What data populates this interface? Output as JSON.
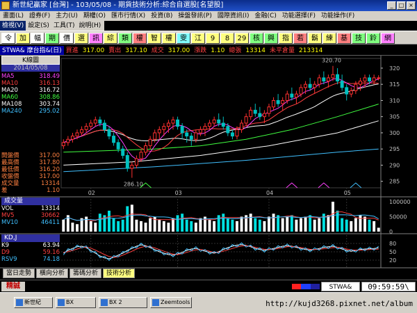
{
  "window": {
    "title": "新世紀贏家 [台灣] - 103/05/08 - 期貨技術分析:綜合自選股[名望股]",
    "controls": [
      "_",
      "□",
      "×"
    ]
  },
  "menu": {
    "items": [
      "畫面(L)",
      "證券(F)",
      "主力(U)",
      "期權(O)",
      "匯市行情(X)",
      "投資(B)",
      "操盤發訊(P)",
      "國際資訊(I)",
      "金融(C)",
      "功能選擇(F)",
      "功能操作(F)"
    ],
    "items2": [
      "檢視(V)",
      "設定(S)",
      "工具(T)",
      "說明(H)"
    ]
  },
  "toolbar": {
    "buttons": [
      {
        "label": "令",
        "color": "#ffffff"
      },
      {
        "label": "加",
        "color": "#ffff80"
      },
      {
        "label": "幅",
        "color": "#ffffff"
      },
      {
        "label": "期",
        "color": "#80ff80"
      },
      {
        "label": "價",
        "color": "#ffffff"
      },
      {
        "label": "選",
        "color": "#ffff80"
      },
      {
        "label": "訊",
        "color": "#ff80ff"
      },
      {
        "label": "綜",
        "color": "#ffff80"
      },
      {
        "label": "類",
        "color": "#80ff80"
      },
      {
        "label": "權",
        "color": "#ff8080"
      },
      {
        "label": "智",
        "color": "#ffff80"
      },
      {
        "label": "權",
        "color": "#ffff80"
      },
      {
        "label": "雯",
        "color": "#80ffff"
      },
      {
        "label": "江",
        "color": "#ffff80"
      },
      {
        "label": "9",
        "color": "#ffff80"
      },
      {
        "label": "8",
        "color": "#ffff80"
      },
      {
        "label": "29",
        "color": "#ffff80"
      },
      {
        "label": "核",
        "color": "#80ff80"
      },
      {
        "label": "興",
        "color": "#80ff80"
      },
      {
        "label": "指",
        "color": "#ffff80"
      },
      {
        "label": "若",
        "color": "#ff8080"
      },
      {
        "label": "鬍",
        "color": "#ffff80"
      },
      {
        "label": "練",
        "color": "#ffff80"
      },
      {
        "label": "基",
        "color": "#ff8080"
      },
      {
        "label": "技",
        "color": "#80ff80"
      },
      {
        "label": "鈴",
        "color": "#80ff80"
      },
      {
        "label": "網",
        "color": "#ff80ff"
      }
    ]
  },
  "info": {
    "symbol": "STWA& 摩台指&(日)",
    "fields": [
      {
        "label": "買進",
        "value": "317.00"
      },
      {
        "label": "賣出",
        "value": "317.10"
      },
      {
        "label": "成交",
        "value": "317.00"
      },
      {
        "label": "漲跌",
        "value": "1.10"
      },
      {
        "label": "總張",
        "value": "13314"
      },
      {
        "label": "未平倉量",
        "value": "213314"
      }
    ]
  },
  "chart": {
    "k_label": "K線圖",
    "date": "2014/05/08",
    "ma_list": [
      {
        "name": "MA5",
        "value": "318.49",
        "color": "#ff40ff"
      },
      {
        "name": "MA10",
        "value": "316.13",
        "color": "#ff4040"
      },
      {
        "name": "MA20",
        "value": "316.72",
        "color": "#ffffff"
      },
      {
        "name": "MA60",
        "value": "308.86",
        "color": "#40ff40"
      },
      {
        "name": "MA108",
        "value": "303.74",
        "color": "#ffffff"
      },
      {
        "name": "MA240",
        "value": "295.02",
        "color": "#40c0ff"
      }
    ],
    "price_list": [
      {
        "name": "開盤價",
        "value": "317.00"
      },
      {
        "name": "最高價",
        "value": "317.80"
      },
      {
        "name": "最低價",
        "value": "316.20"
      },
      {
        "name": "收盤價",
        "value": "317.00"
      },
      {
        "name": "成交量",
        "value": "13314"
      },
      {
        "name": "差",
        "value": "1.10"
      }
    ],
    "high_label": "320.70",
    "low_label": "286.10",
    "y_ticks": [
      "320",
      "315",
      "310",
      "305",
      "300",
      "295",
      "290",
      "285"
    ],
    "x_ticks": [
      "02",
      "03",
      "04",
      "05"
    ],
    "volume": {
      "title": "成交量",
      "rows": [
        {
          "name": "VOL",
          "value": "13314"
        },
        {
          "name": "MV5",
          "value": "30662"
        },
        {
          "name": "MV10",
          "value": "46411"
        }
      ],
      "y_ticks": [
        "100000",
        "50000",
        "0"
      ]
    },
    "kd": {
      "title": "KD,J",
      "rows": [
        {
          "name": "K9",
          "value": "63.94"
        },
        {
          "name": "D9",
          "value": "59.16"
        },
        {
          "name": "RSV9",
          "value": "74.18"
        }
      ],
      "y_ticks": [
        "80",
        "50",
        "20"
      ]
    }
  },
  "chart_data": {
    "type": "candlestick",
    "y_range": [
      283,
      323
    ],
    "ohlc": [
      [
        296,
        298,
        295,
        297
      ],
      [
        297,
        299,
        296,
        298
      ],
      [
        298,
        300,
        297,
        299
      ],
      [
        299,
        301,
        298,
        300
      ],
      [
        300,
        302,
        299,
        301
      ],
      [
        301,
        303,
        300,
        302
      ],
      [
        302,
        304,
        301,
        303
      ],
      [
        303,
        305,
        302,
        304
      ],
      [
        304,
        305,
        302,
        303
      ],
      [
        303,
        304,
        300,
        301
      ],
      [
        301,
        302,
        298,
        299
      ],
      [
        299,
        300,
        296,
        297
      ],
      [
        297,
        298,
        294,
        295
      ],
      [
        295,
        296,
        292,
        293
      ],
      [
        293,
        294,
        288,
        289
      ],
      [
        289,
        291,
        286.1,
        290
      ],
      [
        290,
        293,
        289,
        292
      ],
      [
        292,
        295,
        291,
        294
      ],
      [
        294,
        297,
        293,
        296
      ],
      [
        296,
        299,
        295,
        298
      ],
      [
        298,
        301,
        297,
        300
      ],
      [
        300,
        302,
        298,
        301
      ],
      [
        301,
        303,
        299,
        302
      ],
      [
        302,
        304,
        300,
        303
      ],
      [
        303,
        305,
        301,
        304
      ],
      [
        304,
        305,
        301,
        302
      ],
      [
        302,
        303,
        298,
        300
      ],
      [
        300,
        301,
        297,
        299
      ],
      [
        299,
        300,
        296,
        298
      ],
      [
        298,
        301,
        297,
        300
      ],
      [
        300,
        302,
        299,
        301
      ],
      [
        301,
        303,
        299,
        302
      ],
      [
        302,
        304,
        301,
        303
      ],
      [
        303,
        305,
        302,
        304
      ],
      [
        304,
        306,
        302,
        303
      ],
      [
        303,
        305,
        301,
        302
      ],
      [
        302,
        303,
        299,
        300
      ],
      [
        300,
        301,
        298,
        299
      ],
      [
        299,
        302,
        298,
        301
      ],
      [
        301,
        304,
        300,
        303
      ],
      [
        303,
        306,
        302,
        305
      ],
      [
        305,
        308,
        304,
        307
      ],
      [
        307,
        309,
        305,
        306
      ],
      [
        306,
        308,
        304,
        305
      ],
      [
        305,
        307,
        303,
        306
      ],
      [
        306,
        309,
        305,
        308
      ],
      [
        308,
        311,
        307,
        310
      ],
      [
        310,
        312,
        308,
        309
      ],
      [
        309,
        311,
        307,
        310
      ],
      [
        310,
        313,
        309,
        312
      ],
      [
        312,
        314,
        310,
        311
      ],
      [
        311,
        313,
        309,
        312
      ],
      [
        312,
        315,
        311,
        314
      ],
      [
        314,
        316,
        312,
        315
      ],
      [
        315,
        317,
        313,
        314
      ],
      [
        314,
        316,
        312,
        315
      ],
      [
        315,
        318,
        314,
        317
      ],
      [
        317,
        319,
        315,
        316
      ],
      [
        316,
        318,
        314,
        317
      ],
      [
        317,
        320.7,
        316,
        318
      ],
      [
        318,
        320,
        315,
        316
      ],
      [
        316,
        318,
        313,
        314
      ],
      [
        314,
        315,
        310,
        312
      ],
      [
        312,
        314,
        311,
        313
      ],
      [
        313,
        316,
        312,
        315
      ],
      [
        315,
        317,
        313,
        316
      ],
      [
        316,
        318,
        314,
        317
      ],
      [
        317,
        318,
        315,
        316
      ],
      [
        316,
        318,
        315,
        317
      ],
      [
        317,
        317.8,
        316.2,
        317
      ]
    ],
    "ma": {
      "MA5": [],
      "MA10": [],
      "MA20": []
    },
    "ma60": [
      [
        0,
        294
      ],
      [
        10,
        294.5
      ],
      [
        20,
        295
      ],
      [
        30,
        296
      ],
      [
        40,
        298
      ],
      [
        50,
        301
      ],
      [
        60,
        305
      ],
      [
        69,
        308.9
      ]
    ],
    "ma108": [
      [
        0,
        290
      ],
      [
        15,
        291
      ],
      [
        30,
        293
      ],
      [
        45,
        296
      ],
      [
        60,
        300
      ],
      [
        69,
        303.7
      ]
    ],
    "ma240": [
      [
        0,
        288
      ],
      [
        20,
        289.5
      ],
      [
        40,
        291.5
      ],
      [
        60,
        294
      ],
      [
        69,
        295
      ]
    ],
    "volume": [
      40,
      55,
      30,
      25,
      45,
      50,
      35,
      30,
      60,
      55,
      70,
      45,
      35,
      40,
      85,
      90,
      40,
      35,
      30,
      45,
      50,
      40,
      35,
      30,
      45,
      55,
      60,
      40,
      35,
      30,
      45,
      50,
      40,
      35,
      55,
      60,
      45,
      40,
      35,
      50,
      55,
      60,
      45,
      40,
      35,
      50,
      60,
      55,
      45,
      50,
      55,
      40,
      45,
      50,
      55,
      40,
      45,
      60,
      55,
      100,
      70,
      45,
      40,
      35,
      45,
      55,
      50,
      40,
      35,
      13
    ],
    "k": [
      45,
      55,
      62,
      68,
      70,
      65,
      55,
      45,
      35,
      28,
      25,
      30,
      38,
      45,
      55,
      62,
      70,
      75,
      72,
      65,
      58,
      50,
      45,
      40,
      38,
      42,
      48,
      55,
      60,
      62,
      58,
      52,
      48,
      45,
      50,
      58,
      65,
      70,
      74,
      76,
      73,
      68,
      62,
      58,
      55,
      58,
      62,
      66,
      70,
      72,
      70,
      66,
      62,
      58,
      56,
      58,
      62,
      66,
      68,
      70,
      66,
      60,
      55,
      52,
      55,
      58,
      60,
      61,
      62,
      63.94
    ],
    "d": [
      48,
      50,
      55,
      60,
      65,
      67,
      63,
      56,
      48,
      40,
      33,
      30,
      32,
      38,
      45,
      52,
      60,
      66,
      70,
      68,
      64,
      58,
      52,
      46,
      42,
      40,
      43,
      48,
      53,
      57,
      58,
      56,
      52,
      48,
      48,
      52,
      57,
      62,
      67,
      71,
      72,
      70,
      66,
      62,
      59,
      58,
      59,
      62,
      65,
      68,
      69,
      68,
      65,
      62,
      59,
      58,
      59,
      61,
      63,
      65,
      66,
      64,
      60,
      57,
      56,
      56,
      57,
      58,
      59,
      59.16
    ]
  }
}
